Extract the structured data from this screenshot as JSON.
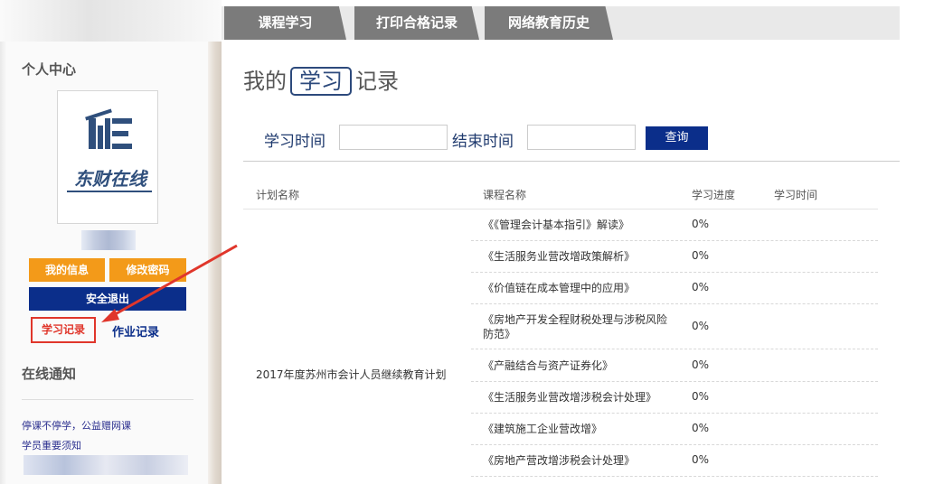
{
  "tabs": [
    {
      "label": "课程学习"
    },
    {
      "label": "打印合格记录"
    },
    {
      "label": "网络教育历史"
    }
  ],
  "sidebar": {
    "title": "个人中心",
    "logo_text": "东财在线",
    "buttons": {
      "my_info": "我的信息",
      "change_password": "修改密码",
      "logout": "安全退出"
    },
    "links": {
      "study_record": "学习记录",
      "homework_record": "作业记录"
    },
    "notice_title": "在线通知",
    "notices": [
      "停课不停学，公益赠网课",
      "学员重要须知"
    ]
  },
  "main": {
    "title_prefix": "我的",
    "title_highlight": "学习",
    "title_suffix": "记录",
    "filter": {
      "start_label": "学习时间",
      "end_label": "结束时间",
      "query_button": "查询"
    },
    "table": {
      "headers": [
        "计划名称",
        "课程名称",
        "学习进度",
        "学习时间"
      ],
      "plan_name": "2017年度苏州市会计人员继续教育计划",
      "rows": [
        {
          "course": "《《管理会计基本指引》解读》",
          "progress": "0%"
        },
        {
          "course": "《生活服务业营改增政策解析》",
          "progress": "0%"
        },
        {
          "course": "《价值链在成本管理中的应用》",
          "progress": "0%"
        },
        {
          "course": "《房地产开发全程财税处理与涉税风险防范》",
          "progress": "0%"
        },
        {
          "course": "《产融结合与资产证券化》",
          "progress": "0%"
        },
        {
          "course": "《生活服务业营改增涉税会计处理》",
          "progress": "0%"
        },
        {
          "course": "《建筑施工企业营改增》",
          "progress": "0%"
        },
        {
          "course": "《房地产营改增涉税会计处理》",
          "progress": "0%"
        }
      ]
    }
  },
  "colors": {
    "tab_bg": "#7b7b7b",
    "orange": "#f39a19",
    "navy": "#0b2e8a",
    "highlight_red": "#e0362b"
  }
}
